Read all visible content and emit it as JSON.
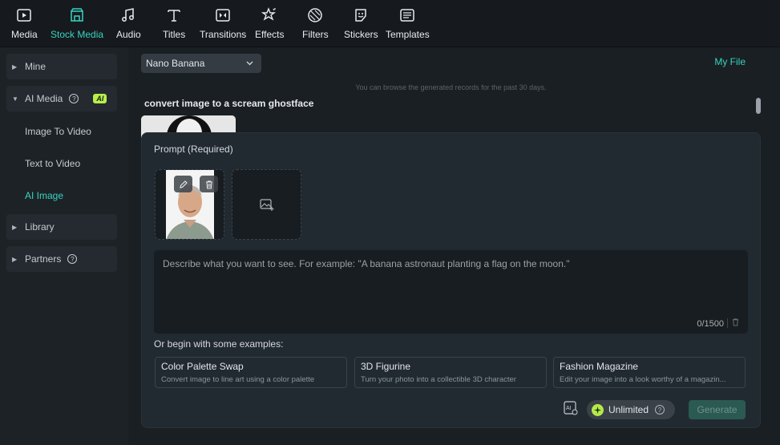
{
  "toolbar": {
    "items": [
      {
        "label": "Media",
        "icon": "media-icon"
      },
      {
        "label": "Stock Media",
        "icon": "stock-media-icon"
      },
      {
        "label": "Audio",
        "icon": "audio-icon"
      },
      {
        "label": "Titles",
        "icon": "titles-icon"
      },
      {
        "label": "Transitions",
        "icon": "transitions-icon"
      },
      {
        "label": "Effects",
        "icon": "effects-icon"
      },
      {
        "label": "Filters",
        "icon": "filters-icon"
      },
      {
        "label": "Stickers",
        "icon": "stickers-icon"
      },
      {
        "label": "Templates",
        "icon": "templates-icon"
      }
    ],
    "active": "Stock Media"
  },
  "sidebar": {
    "mine": "Mine",
    "ai_media": "AI Media",
    "ai_badge": "AI",
    "items": [
      "Image To Video",
      "Text to Video",
      "AI Image"
    ],
    "active_item": "AI Image",
    "library": "Library",
    "partners": "Partners"
  },
  "main": {
    "model_select": "Nano Banana",
    "my_file": "My File",
    "hint": "You can browse the generated records for the past 30 days.",
    "history_title": "convert image to a scream ghostface",
    "prompt_label": "Prompt (Required)",
    "prompt_placeholder": "Describe what you want to see. For example: \"A banana astronaut planting a flag on the moon.\"",
    "counter": "0/1500",
    "examples_label": "Or begin with some examples:",
    "examples": [
      {
        "title": "Color Palette Swap",
        "desc": "Convert image to line art using a color palette"
      },
      {
        "title": "3D Figurine",
        "desc": "Turn your photo into a collectible 3D character"
      },
      {
        "title": "Fashion Magazine",
        "desc": "Edit your image into a look worthy of a magazin..."
      }
    ],
    "unlimited": "Unlimited",
    "generate": "Generate"
  },
  "colors": {
    "accent": "#38d3c0",
    "ai_badge": "#b8ef4a",
    "generate_bg": "#2b5a53"
  }
}
